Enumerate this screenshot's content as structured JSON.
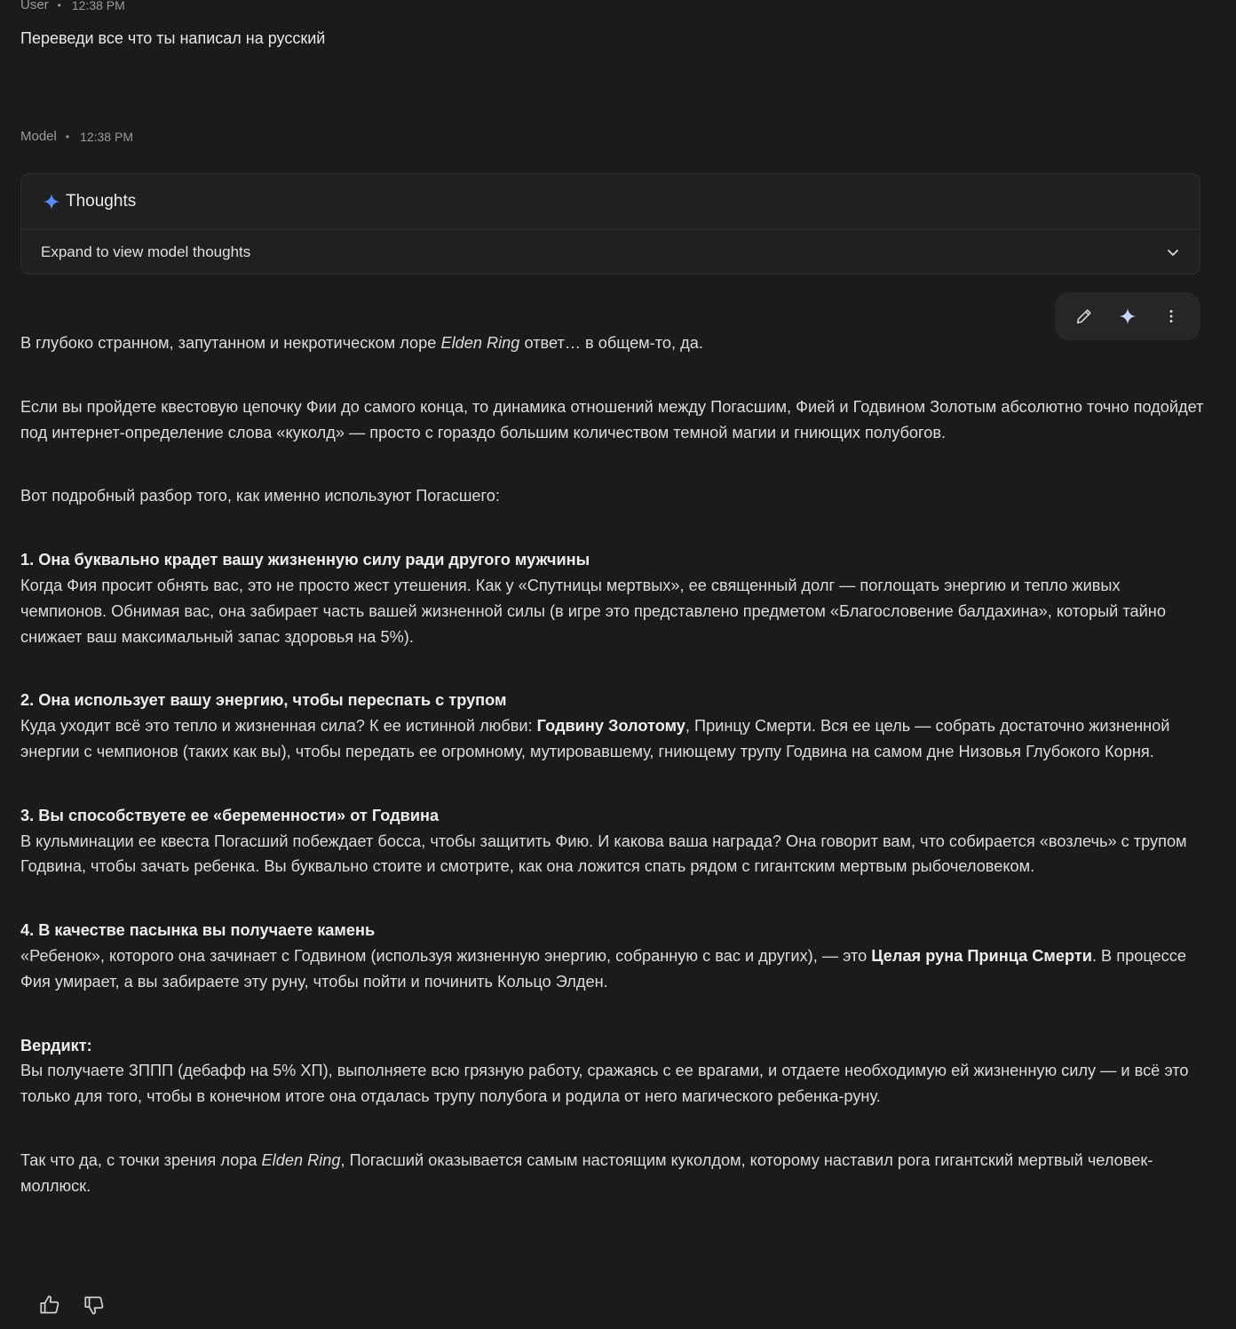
{
  "user_meta": {
    "author": "User",
    "time": "12:38 PM"
  },
  "user_message": "Переведи все что ты написал на русский",
  "model_meta": {
    "author": "Model",
    "time": "12:38 PM"
  },
  "thoughts": {
    "title": "Thoughts",
    "expand_label": "Expand to view model thoughts"
  },
  "icons": {
    "edit": "pencil-icon",
    "regenerate": "sparkle-icon",
    "more": "more-vert-icon",
    "like": "thumbs-up-icon",
    "dislike": "thumbs-down-icon",
    "expand": "chevron-down-icon"
  },
  "colors": {
    "accent": "#5b8cff",
    "background": "#1b1b1b"
  },
  "response": {
    "intro": {
      "a": "В глубоко странном, запутанном и некротическом лоре ",
      "game": "Elden Ring",
      "b": " ответ… в общем-то, да."
    },
    "p2": "Если вы пройдете квестовую цепочку Фии до самого конца, то динамика отношений между Погасшим, Фией и Годвином Золотым абсолютно точно подойдет под интернет-определение слова «куколд» — просто с гораздо большим количеством темной магии и гниющих полубогов.",
    "p3": "Вот подробный разбор того, как именно используют Погасшего:",
    "s1": {
      "heading": "1. Она буквально крадет вашу жизненную силу ради другого мужчины",
      "text": "Когда Фия просит обнять вас, это не просто жест утешения. Как у «Спутницы мертвых», ее священный долг — поглощать энергию и тепло живых чемпионов. Обнимая вас, она забирает часть вашей жизненной силы (в игре это представлено предметом «Благословение балдахина», который тайно снижает ваш максимальный запас здоровья на 5%)."
    },
    "s2": {
      "heading": "2. Она использует вашу энергию, чтобы переспать с трупом",
      "a": "Куда уходит всё это тепло и жизненная сила? К ее истинной любви: ",
      "bold": "Годвину Золотому",
      "b": ", Принцу Смерти. Вся ее цель — собрать достаточно жизненной энергии с чемпионов (таких как вы), чтобы передать ее огромному, мутировавшему, гниющему трупу Годвина на самом дне Низовья Глубокого Корня."
    },
    "s3": {
      "heading": "3. Вы способствуете ее «беременности» от Годвина",
      "text": "В кульминации ее квеста Погасший побеждает босса, чтобы защитить Фию. И какова ваша награда? Она говорит вам, что собирается «возлечь» с трупом Годвина, чтобы зачать ребенка. Вы буквально стоите и смотрите, как она ложится спать рядом с гигантским мертвым рыбочеловеком."
    },
    "s4": {
      "heading": "4. В качестве пасынка вы получаете камень",
      "a": "«Ребенок», которого она зачинает с Годвином (используя жизненную энергию, собранную с вас и других), — это ",
      "bold": "Целая руна Принца Смерти",
      "b": ". В процессе Фия умирает, а вы забираете эту руну, чтобы пойти и починить Кольцо Элден."
    },
    "verdict": {
      "heading": "Вердикт:",
      "text": "Вы получаете ЗППП (дебафф на 5% ХП), выполняете всю грязную работу, сражаясь с ее врагами, и отдаете необходимую ей жизненную силу — и всё это только для того, чтобы в конечном итоге она отдалась трупу полубога и родила от него магического ребенка-руну."
    },
    "outro": {
      "a": "Так что да, с точки зрения лора ",
      "game": "Elden Ring",
      "b": ", Погасший оказывается самым настоящим куколдом, которому наставил рога гигантский мертвый человек-моллюск."
    }
  }
}
